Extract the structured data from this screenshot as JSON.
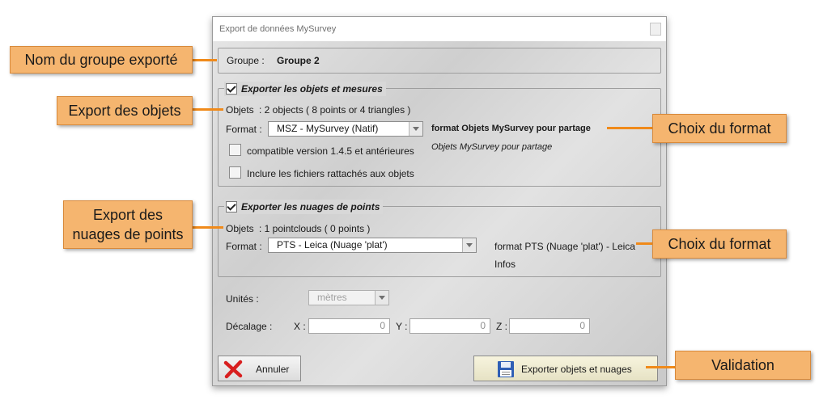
{
  "window": {
    "title": "Export de données MySurvey"
  },
  "group_row": {
    "label": "Groupe :",
    "value": "Groupe 2"
  },
  "objects_section": {
    "checkbox_label": "Exporter les objets et mesures",
    "objects_label": "Objets",
    "objects_value": ": 2 objects ( 8 points or 4 triangles )",
    "format_label": "Format :",
    "format_value": "MSZ - MySurvey (Natif)",
    "format_title": "format Objets MySurvey pour partage",
    "format_desc": "Objets MySurvey pour partage",
    "option_compat": "compatible version 1.4.5 et antérieures",
    "option_attached": "Inclure les fichiers rattachés aux objets"
  },
  "clouds_section": {
    "checkbox_label": "Exporter les nuages de points",
    "objects_label": "Objets",
    "objects_value": ": 1 pointclouds ( 0 points )",
    "format_label": "Format :",
    "format_value": "PTS - Leica (Nuage 'plat')",
    "format_title": "format PTS (Nuage 'plat') - Leica",
    "format_desc": "Infos"
  },
  "units": {
    "label": "Unités :",
    "value": "mètres"
  },
  "offset": {
    "label": "Décalage :",
    "x_label": "X :",
    "x_value": "0",
    "y_label": "Y :",
    "y_value": "0",
    "z_label": "Z :",
    "z_value": "0"
  },
  "buttons": {
    "cancel": "Annuler",
    "export": "Exporter objets et nuages"
  },
  "callouts": {
    "group_name": "Nom du groupe exporté",
    "export_objects": "Export des objets",
    "choose_format_1": "Choix du format",
    "export_clouds_line1": "Export des",
    "export_clouds_line2": "nuages de points",
    "choose_format_2": "Choix du format",
    "validation": "Validation"
  },
  "colors": {
    "callout_bg": "#f5b56f",
    "connector": "#f08a1a",
    "cancel_icon": "#d81f1f",
    "disk_icon": "#2f5fb5"
  }
}
